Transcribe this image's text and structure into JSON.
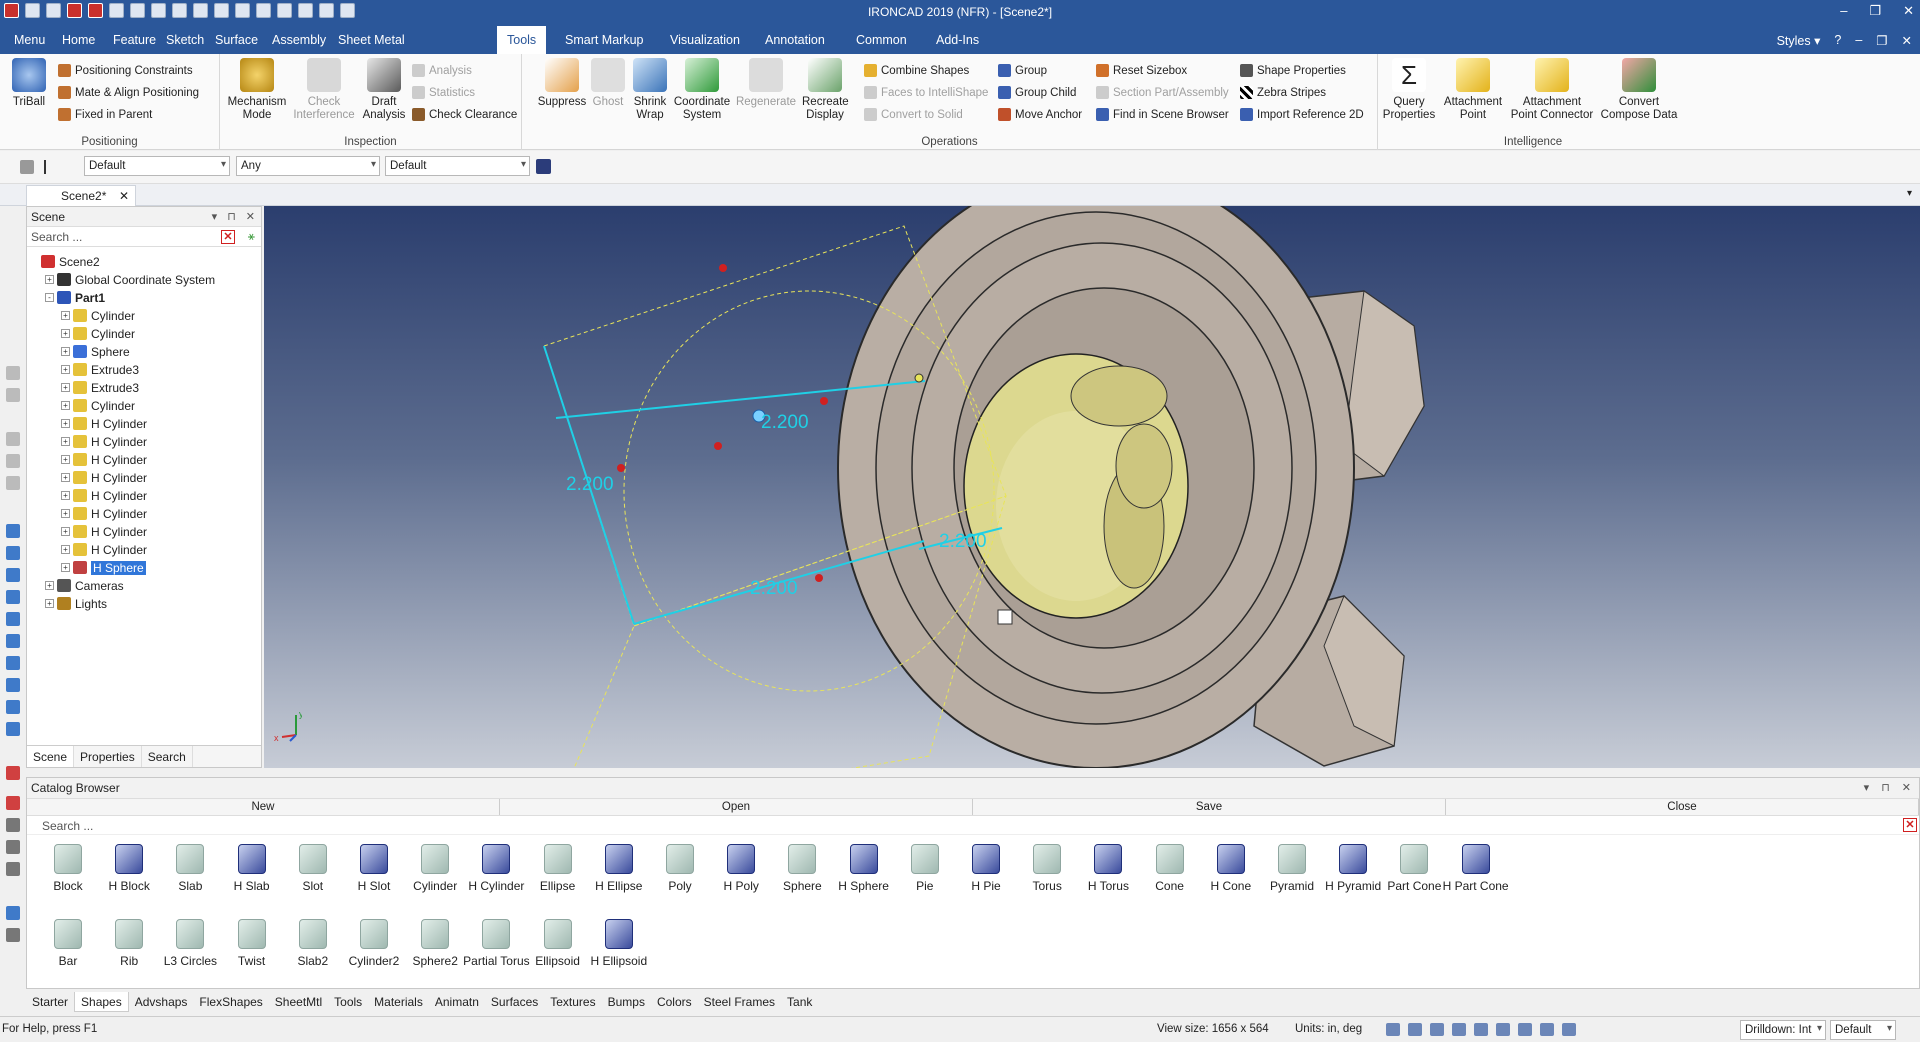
{
  "app": {
    "title": "IRONCAD 2019 (NFR) - [Scene2*]",
    "styles_label": "Styles"
  },
  "menu": {
    "items": [
      "Menu",
      "Home",
      "Feature",
      "Sketch",
      "Surface",
      "Assembly",
      "Sheet Metal",
      "Tools",
      "Smart Markup",
      "Visualization",
      "Annotation",
      "Common",
      "Add-Ins"
    ],
    "active": "Tools"
  },
  "ribbon": {
    "positioning": {
      "label": "Positioning",
      "triball": "TriBall",
      "positioning_constraints": "Positioning Constraints",
      "mate_align": "Mate & Align Positioning",
      "fixed_in_parent": "Fixed in Parent"
    },
    "inspection": {
      "label": "Inspection",
      "mechanism_mode_1": "Mechanism",
      "mechanism_mode_2": "Mode",
      "check_interference_1": "Check",
      "check_interference_2": "Interference",
      "draft_analysis_1": "Draft",
      "draft_analysis_2": "Analysis",
      "analysis": "Analysis",
      "statistics": "Statistics",
      "check_clearance": "Check Clearance"
    },
    "operations": {
      "label": "Operations",
      "suppress": "Suppress",
      "ghost": "Ghost",
      "shrink_wrap_1": "Shrink",
      "shrink_wrap_2": "Wrap",
      "coordinate_system_1": "Coordinate",
      "coordinate_system_2": "System",
      "regenerate": "Regenerate",
      "recreate_display_1": "Recreate",
      "recreate_display_2": "Display",
      "combine_shapes": "Combine Shapes",
      "faces_to_intellishape": "Faces to IntelliShape",
      "convert_to_solid": "Convert to Solid",
      "group": "Group",
      "group_child": "Group Child",
      "move_anchor": "Move Anchor",
      "reset_sizebox": "Reset Sizebox",
      "section_part_assembly": "Section Part/Assembly",
      "find_in_scene_browser": "Find in Scene Browser",
      "shape_properties": "Shape Properties",
      "zebra_stripes": "Zebra Stripes",
      "import_reference_2d": "Import Reference 2D"
    },
    "intelligence": {
      "label": "Intelligence",
      "query_properties_1": "Query",
      "query_properties_2": "Properties",
      "attachment_point_1": "Attachment",
      "attachment_point_2": "Point",
      "attachment_point_connector_1": "Attachment",
      "attachment_point_connector_2": "Point Connector",
      "convert_compose_data_1": "Convert",
      "convert_compose_data_2": "Compose Data"
    }
  },
  "toolbar": {
    "combo1": "Default",
    "combo2": "Any",
    "combo3": "Default"
  },
  "doc_tab": "Scene2*",
  "scene": {
    "title": "Scene",
    "search_placeholder": "Search ...",
    "tree": [
      {
        "label": "Scene2",
        "level": 0,
        "exp": "",
        "color": "#d03030"
      },
      {
        "label": "Global Coordinate System",
        "level": 1,
        "exp": "+",
        "color": "#333333"
      },
      {
        "label": "Part1",
        "level": 1,
        "exp": "-",
        "color": "#2d55b8"
      },
      {
        "label": "Cylinder",
        "level": 2,
        "exp": "+",
        "color": "#e5c23a"
      },
      {
        "label": "Cylinder",
        "level": 2,
        "exp": "+",
        "color": "#e5c23a"
      },
      {
        "label": "Sphere",
        "level": 2,
        "exp": "+",
        "color": "#3a6fd8"
      },
      {
        "label": "Extrude3",
        "level": 2,
        "exp": "+",
        "color": "#e5c23a"
      },
      {
        "label": "Extrude3",
        "level": 2,
        "exp": "+",
        "color": "#e5c23a"
      },
      {
        "label": "Cylinder",
        "level": 2,
        "exp": "+",
        "color": "#e5c23a"
      },
      {
        "label": "H Cylinder",
        "level": 2,
        "exp": "+",
        "color": "#e5c23a"
      },
      {
        "label": "H Cylinder",
        "level": 2,
        "exp": "+",
        "color": "#e5c23a"
      },
      {
        "label": "H Cylinder",
        "level": 2,
        "exp": "+",
        "color": "#e5c23a"
      },
      {
        "label": "H Cylinder",
        "level": 2,
        "exp": "+",
        "color": "#e5c23a"
      },
      {
        "label": "H Cylinder",
        "level": 2,
        "exp": "+",
        "color": "#e5c23a"
      },
      {
        "label": "H Cylinder",
        "level": 2,
        "exp": "+",
        "color": "#e5c23a"
      },
      {
        "label": "H Cylinder",
        "level": 2,
        "exp": "+",
        "color": "#e5c23a"
      },
      {
        "label": "H Cylinder",
        "level": 2,
        "exp": "+",
        "color": "#e5c23a"
      },
      {
        "label": "H Sphere",
        "level": 2,
        "exp": "+",
        "color": "#c04040",
        "selected": true
      },
      {
        "label": "Cameras",
        "level": 1,
        "exp": "+",
        "color": "#555555"
      },
      {
        "label": "Lights",
        "level": 1,
        "exp": "+",
        "color": "#b08020"
      }
    ],
    "tabs": [
      "Scene",
      "Properties",
      "Search"
    ]
  },
  "viewport": {
    "dim1": "2.200",
    "dim2": "2.200",
    "dim3": "2.200",
    "dim4": "2.200",
    "axis_x": "x",
    "axis_y": "y"
  },
  "catalog": {
    "title": "Catalog Browser",
    "buttons": [
      "New",
      "Open",
      "Save",
      "Close"
    ],
    "search_placeholder": "Search ...",
    "shapes_row1": [
      "Block",
      "H Block",
      "Slab",
      "H Slab",
      "Slot",
      "H Slot",
      "Cylinder",
      "H Cylinder",
      "Ellipse",
      "H Ellipse",
      "Poly",
      "H Poly",
      "Sphere",
      "H Sphere",
      "Pie",
      "H Pie",
      "Torus",
      "H Torus",
      "Cone",
      "H Cone",
      "Pyramid",
      "H Pyramid",
      "Part Cone",
      "H Part Cone"
    ],
    "shapes_row2": [
      "Bar",
      "Rib",
      "L3 Circles",
      "Twist",
      "Slab2",
      "Cylinder2",
      "Sphere2",
      "Partial Torus",
      "Ellipsoid",
      "H Ellipsoid"
    ],
    "tabs": [
      "Starter",
      "Shapes",
      "Advshaps",
      "FlexShapes",
      "SheetMtl",
      "Tools",
      "Materials",
      "Animatn",
      "Surfaces",
      "Textures",
      "Bumps",
      "Colors",
      "Steel Frames",
      "Tank"
    ],
    "active_tab": "Shapes"
  },
  "status": {
    "help": "For Help, press F1",
    "view_size": "View size: 1656 x  564",
    "units": "Units: in, deg",
    "drilldown": "Drilldown: Int",
    "default": "Default"
  }
}
